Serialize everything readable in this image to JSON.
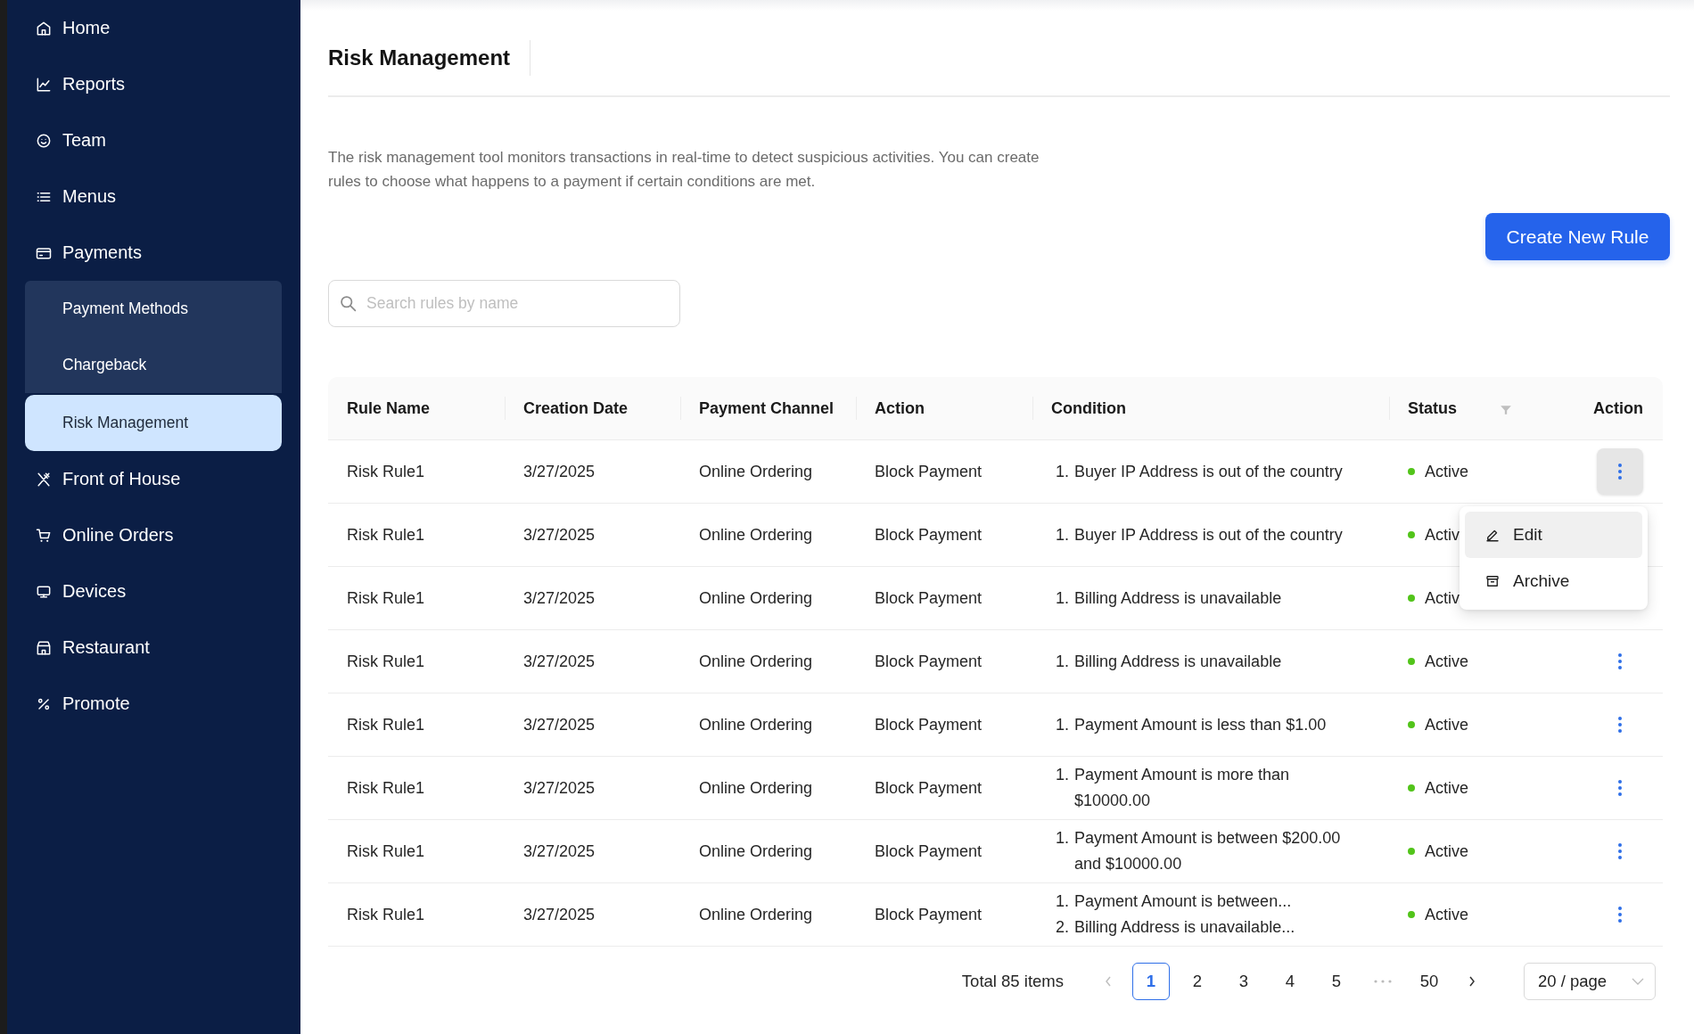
{
  "sidebar": {
    "items": [
      {
        "label": "Home",
        "selected": false
      },
      {
        "label": "Reports",
        "selected": false
      },
      {
        "label": "Team",
        "selected": false
      },
      {
        "label": "Menus",
        "selected": false
      },
      {
        "label": "Payments",
        "selected": false,
        "expanded": true,
        "children": [
          {
            "label": "Payment Methods",
            "selected": false
          },
          {
            "label": "Chargeback",
            "selected": false
          },
          {
            "label": "Risk Management",
            "selected": true
          }
        ]
      },
      {
        "label": "Front of House",
        "selected": false
      },
      {
        "label": "Online Orders",
        "selected": false
      },
      {
        "label": "Devices",
        "selected": false
      },
      {
        "label": "Restaurant",
        "selected": false
      },
      {
        "label": "Promote",
        "selected": false
      }
    ]
  },
  "page": {
    "title": "Risk Management",
    "description": "The risk management tool monitors transactions in real-time to detect suspicious activities. You can create rules to choose what happens to a payment if certain conditions are met.",
    "create_button": "Create New Rule"
  },
  "search": {
    "placeholder": "Search rules by name"
  },
  "table": {
    "columns": [
      "Rule Name",
      "Creation Date",
      "Payment Channel",
      "Action",
      "Condition",
      "Status",
      "Action"
    ],
    "rows": [
      {
        "name": "Risk Rule1",
        "date": "3/27/2025",
        "channel": "Online Ordering",
        "action": "Block Payment",
        "conditions": [
          {
            "number": "1.",
            "text": "Buyer IP Address is out of the country"
          }
        ],
        "status": "Active",
        "menu_open": true
      },
      {
        "name": "Risk Rule1",
        "date": "3/27/2025",
        "channel": "Online Ordering",
        "action": "Block Payment",
        "conditions": [
          {
            "number": "1.",
            "text": "Buyer IP Address is out of the country"
          }
        ],
        "status": "Activ",
        "menu_open": false
      },
      {
        "name": "Risk Rule1",
        "date": "3/27/2025",
        "channel": "Online Ordering",
        "action": "Block Payment",
        "conditions": [
          {
            "number": "1.",
            "text": "Billing Address is unavailable"
          }
        ],
        "status": "Activ",
        "menu_open": false
      },
      {
        "name": "Risk Rule1",
        "date": "3/27/2025",
        "channel": "Online Ordering",
        "action": "Block Payment",
        "conditions": [
          {
            "number": "1.",
            "text": "Billing Address is unavailable"
          }
        ],
        "status": "Active",
        "menu_open": false
      },
      {
        "name": "Risk Rule1",
        "date": "3/27/2025",
        "channel": "Online Ordering",
        "action": "Block Payment",
        "conditions": [
          {
            "number": "1.",
            "text": "Payment Amount is less than $1.00"
          }
        ],
        "status": "Active",
        "menu_open": false
      },
      {
        "name": "Risk Rule1",
        "date": "3/27/2025",
        "channel": "Online Ordering",
        "action": "Block Payment",
        "conditions": [
          {
            "number": "1.",
            "text": "Payment Amount is more than $10000.00"
          }
        ],
        "status": "Active",
        "menu_open": false
      },
      {
        "name": "Risk Rule1",
        "date": "3/27/2025",
        "channel": "Online Ordering",
        "action": "Block Payment",
        "conditions": [
          {
            "number": "1.",
            "text": "Payment Amount is between $200.00 and $10000.00"
          }
        ],
        "status": "Active",
        "menu_open": false
      },
      {
        "name": "Risk Rule1",
        "date": "3/27/2025",
        "channel": "Online Ordering",
        "action": "Block Payment",
        "conditions": [
          {
            "number": "1.",
            "text": "Payment Amount is between..."
          },
          {
            "number": "2.",
            "text": "Billing Address is unavailable..."
          }
        ],
        "status": "Active",
        "menu_open": false
      }
    ]
  },
  "row_menu": {
    "items": [
      {
        "label": "Edit",
        "selected": true
      },
      {
        "label": "Archive",
        "selected": false
      }
    ]
  },
  "pagination": {
    "total": "Total 85 items",
    "pages": [
      {
        "label": "1",
        "selected": true
      },
      {
        "label": "2",
        "selected": false
      },
      {
        "label": "3",
        "selected": false
      },
      {
        "label": "4",
        "selected": false
      },
      {
        "label": "5",
        "selected": false
      },
      {
        "label": "50",
        "selected": false
      }
    ],
    "page_size": "20 / page"
  }
}
